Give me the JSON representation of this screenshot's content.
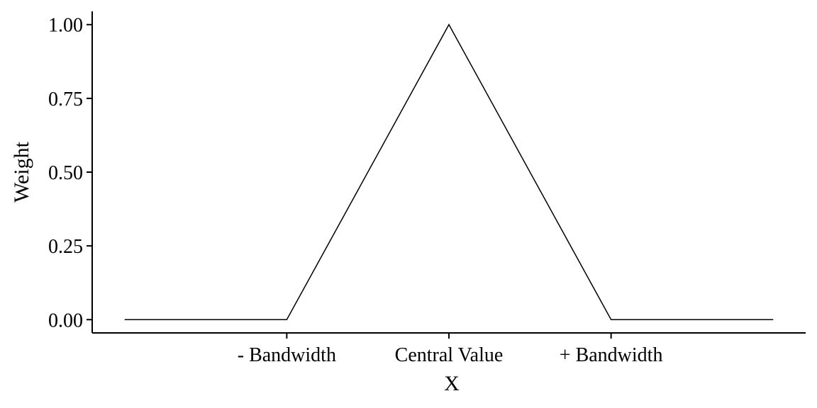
{
  "chart_data": {
    "type": "line",
    "title": "",
    "xlabel": "X",
    "ylabel": "Weight",
    "x": [
      -2,
      -1,
      0,
      1,
      2
    ],
    "series": [
      {
        "values": [
          0,
          0,
          1,
          0,
          0
        ]
      }
    ],
    "xlim": [
      -2.2,
      2.2
    ],
    "ylim": [
      -0.045,
      1.045
    ],
    "x_ticks": [
      {
        "value": -1,
        "label": "- Bandwidth"
      },
      {
        "value": 0,
        "label": "Central Value"
      },
      {
        "value": 1,
        "label": "+ Bandwidth"
      }
    ],
    "y_ticks": [
      {
        "value": 0,
        "label": "0.00"
      },
      {
        "value": 0.25,
        "label": "0.25"
      },
      {
        "value": 0.5,
        "label": "0.50"
      },
      {
        "value": 0.75,
        "label": "0.75"
      },
      {
        "value": 1,
        "label": "1.00"
      }
    ],
    "grid": false,
    "legend": "none",
    "line_color": "#000000"
  }
}
